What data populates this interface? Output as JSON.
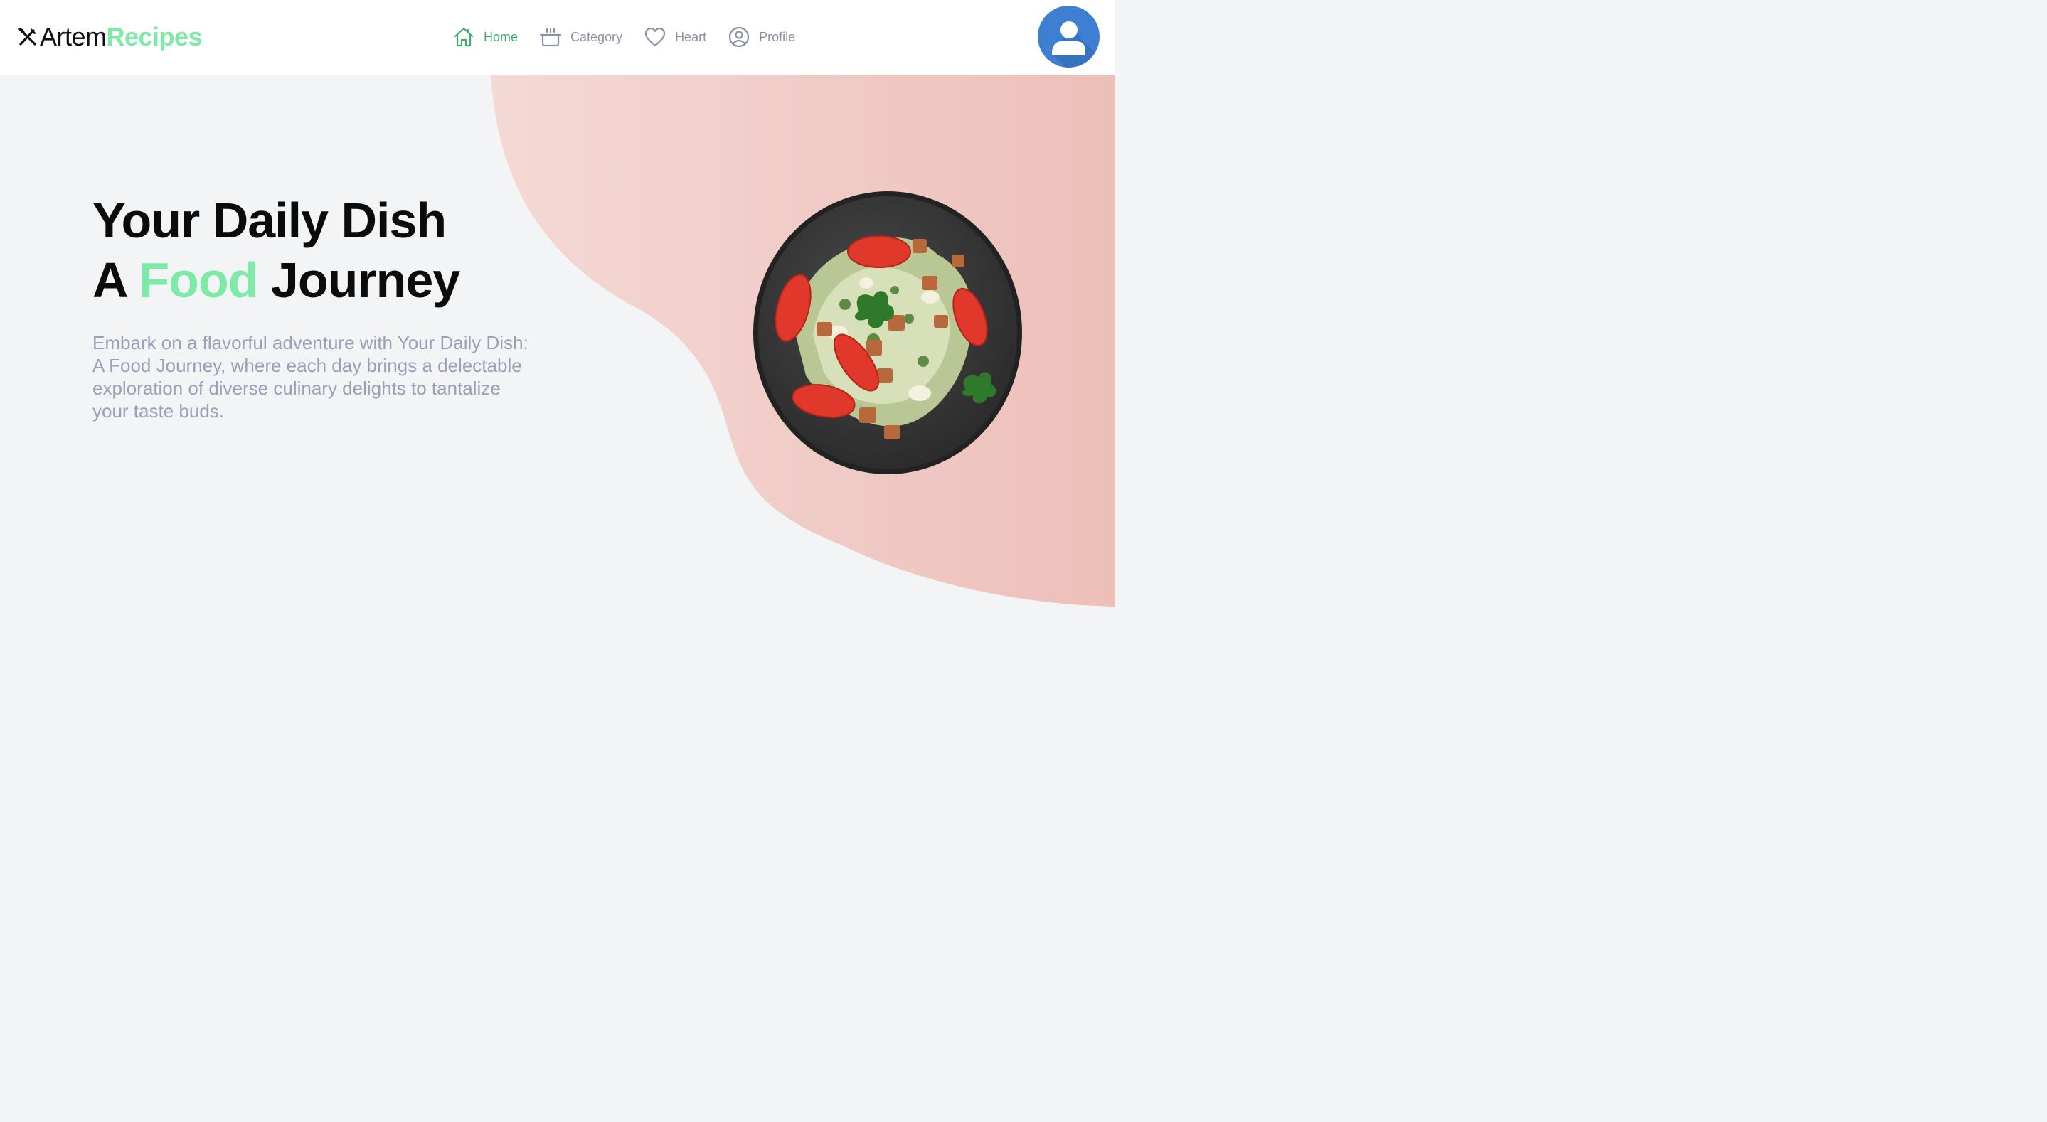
{
  "header": {
    "logo": {
      "part1": "Artem",
      "part2": "Recipes",
      "icon": "fork-knife-icon"
    },
    "nav": [
      {
        "label": "Home",
        "icon": "home-icon",
        "active": true
      },
      {
        "label": "Category",
        "icon": "pot-icon",
        "active": false
      },
      {
        "label": "Heart",
        "icon": "heart-icon",
        "active": false
      },
      {
        "label": "Profile",
        "icon": "user-circle-icon",
        "active": false
      }
    ],
    "avatar_icon": "user-avatar-icon"
  },
  "hero": {
    "title_line1": "Your Daily Dish",
    "title_line2_prefix": "A",
    "title_line2_accent": "Food",
    "title_line2_suffix": "Journey",
    "description": "Embark on a flavorful adventure with Your Daily Dish: A Food Journey, where each day brings a delectable exploration of diverse culinary delights to tantalize your taste buds.",
    "image": "salad-plate-image"
  },
  "colors": {
    "accent_green": "#7eeaa8",
    "active_nav": "#3fae6b",
    "muted_text": "#9aa0b6",
    "nav_text": "#8b92a6",
    "blob_pink": "#efc3bd",
    "avatar_blue": "#3f7fd1",
    "background": "#f3f4f6"
  }
}
